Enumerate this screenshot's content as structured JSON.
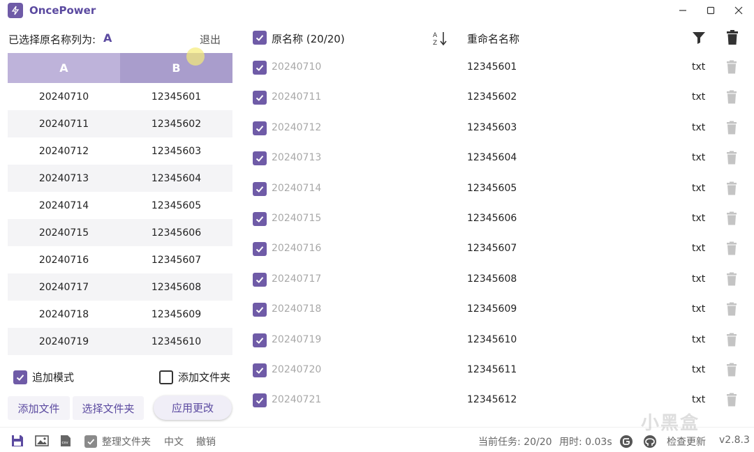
{
  "app": {
    "title": "OncePower",
    "version": "v2.8.3"
  },
  "left": {
    "selected_label": "已选择原名称列为:",
    "selected_value": "A",
    "exit_label": "退出",
    "columns": [
      "A",
      "B"
    ],
    "rows": [
      [
        "20240710",
        "12345601"
      ],
      [
        "20240711",
        "12345602"
      ],
      [
        "20240712",
        "12345603"
      ],
      [
        "20240713",
        "12345604"
      ],
      [
        "20240714",
        "12345605"
      ],
      [
        "20240715",
        "12345606"
      ],
      [
        "20240716",
        "12345607"
      ],
      [
        "20240717",
        "12345608"
      ],
      [
        "20240718",
        "12345609"
      ],
      [
        "20240719",
        "12345610"
      ]
    ],
    "append_mode": {
      "label": "追加模式",
      "checked": true
    },
    "add_folder": {
      "label": "添加文件夹",
      "checked": false
    },
    "buttons": {
      "add_file": "添加文件",
      "select_folder": "选择文件夹",
      "apply": "应用更改"
    }
  },
  "right": {
    "header_original": "原名称 (20/20)",
    "header_rename": "重命名名称",
    "rows": [
      {
        "original": "20240710",
        "rename": "12345601",
        "ext": "txt"
      },
      {
        "original": "20240711",
        "rename": "12345602",
        "ext": "txt"
      },
      {
        "original": "20240712",
        "rename": "12345603",
        "ext": "txt"
      },
      {
        "original": "20240713",
        "rename": "12345604",
        "ext": "txt"
      },
      {
        "original": "20240714",
        "rename": "12345605",
        "ext": "txt"
      },
      {
        "original": "20240715",
        "rename": "12345606",
        "ext": "txt"
      },
      {
        "original": "20240716",
        "rename": "12345607",
        "ext": "txt"
      },
      {
        "original": "20240717",
        "rename": "12345608",
        "ext": "txt"
      },
      {
        "original": "20240718",
        "rename": "12345609",
        "ext": "txt"
      },
      {
        "original": "20240719",
        "rename": "12345610",
        "ext": "txt"
      },
      {
        "original": "20240720",
        "rename": "12345611",
        "ext": "txt"
      },
      {
        "original": "20240721",
        "rename": "12345612",
        "ext": "txt"
      }
    ]
  },
  "status": {
    "organize_folder": "整理文件夹",
    "language": "中文",
    "undo": "撤销",
    "task": "当前任务: 20/20",
    "elapsed": "用时: 0.03s",
    "check_update": "检查更新"
  },
  "watermark": "小黑盒",
  "colors": {
    "accent": "#6f5ba7",
    "header_a": "#beb3da",
    "header_b": "#a99dcc"
  },
  "icons": [
    "app-logo-icon",
    "minimize-icon",
    "maximize-icon",
    "close-icon",
    "sort-icon",
    "filter-icon",
    "trash-icon",
    "save-icon",
    "image-icon",
    "csv-icon",
    "gitee-icon",
    "github-icon"
  ]
}
